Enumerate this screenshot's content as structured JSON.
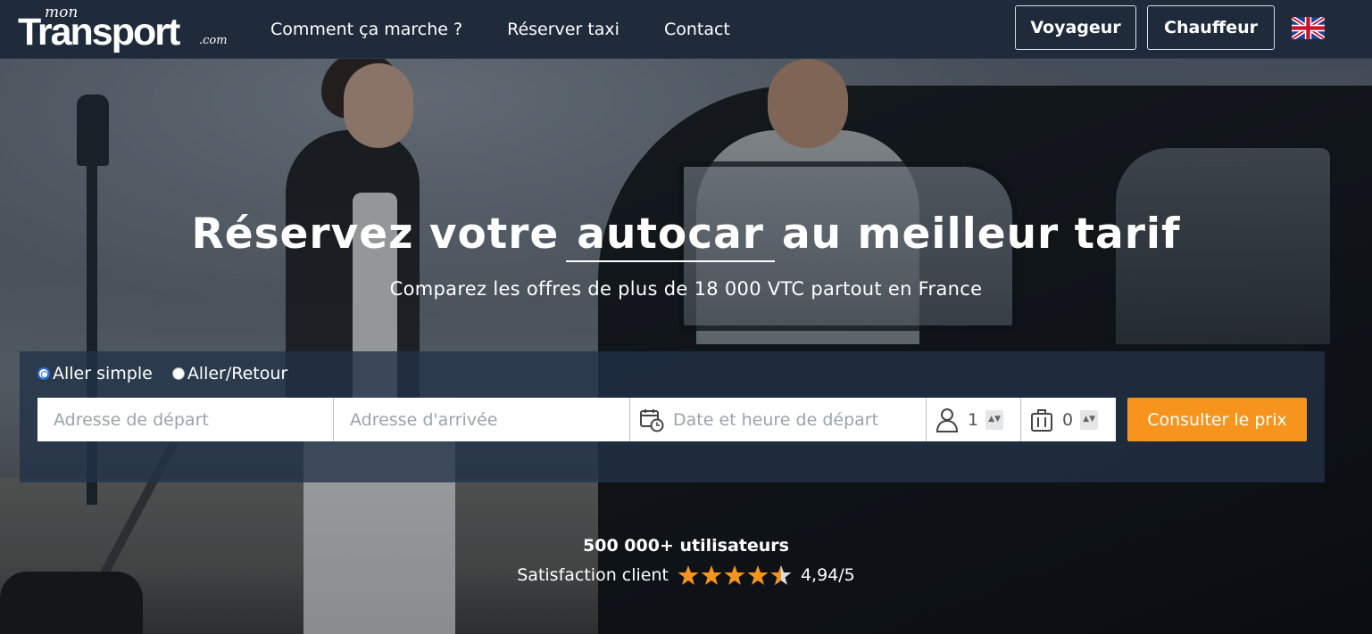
{
  "header": {
    "logo": {
      "mon": "mon",
      "transport": "Transport",
      "com": ".com"
    },
    "nav": [
      "Comment ça marche ?",
      "Réserver taxi",
      "Contact"
    ],
    "buttons": {
      "voyageur": "Voyageur",
      "chauffeur": "Chauffeur"
    },
    "language_icon": "uk-flag-icon"
  },
  "hero": {
    "headline_before": "Réservez votre",
    "headline_word": "autocar",
    "headline_after": "au meilleur tarif",
    "subline": "Comparez les offres de plus de 18 000 VTC partout en France"
  },
  "search": {
    "trip_types": {
      "simple": "Aller simple",
      "retour": "Aller/Retour",
      "selected": "Aller simple"
    },
    "depart_placeholder": "Adresse de départ",
    "arrivee_placeholder": "Adresse d'arrivée",
    "date_placeholder": "Date et heure de départ",
    "passengers": "1",
    "bags": "0",
    "submit": "Consulter le prix"
  },
  "stats": {
    "users": "500 000+ utilisateurs",
    "satisfaction_label": "Satisfaction client",
    "score": "4,94/5",
    "stars": 4.94
  },
  "colors": {
    "header_bg": "#1f2b3a",
    "accent": "#f7941d",
    "star": "#f7941d"
  }
}
